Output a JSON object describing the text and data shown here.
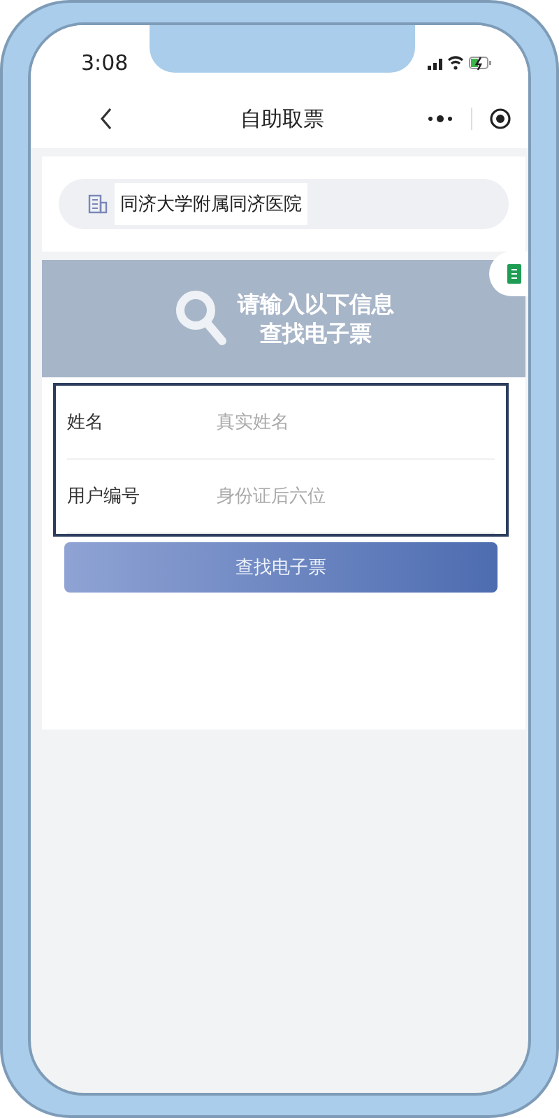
{
  "status_bar": {
    "time": "3:08"
  },
  "nav": {
    "title": "自助取票"
  },
  "hospital": {
    "name": "同济大学附属同济医院"
  },
  "banner": {
    "lines": [
      "请输入以下信息",
      "查找电子票"
    ]
  },
  "form": {
    "fields": [
      {
        "label": "姓名",
        "placeholder": "真实姓名"
      },
      {
        "label": "用户编号",
        "placeholder": "身份证后六位"
      }
    ]
  },
  "submit_button": {
    "label": "查找电子票"
  }
}
